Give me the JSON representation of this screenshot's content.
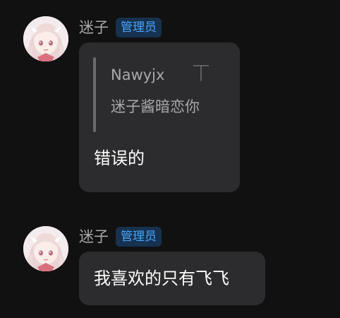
{
  "messages": [
    {
      "sender": "迷子",
      "role_badge": "管理员",
      "avatar_icon": "anime-girl-avatar",
      "quote": {
        "author": "Nawyjx",
        "arrow_icon": "quote-jump-icon",
        "arrow_glyph": "⏉",
        "text": "迷子酱暗恋你"
      },
      "text": "错误的"
    },
    {
      "sender": "迷子",
      "role_badge": "管理员",
      "avatar_icon": "anime-girl-avatar",
      "text": "我喜欢的只有飞飞"
    }
  ],
  "colors": {
    "background": "#111112",
    "bubble": "#2c2c2e",
    "badge_bg": "#16324f",
    "badge_text": "#4aa3ff",
    "name_text": "#a8a8ab"
  }
}
